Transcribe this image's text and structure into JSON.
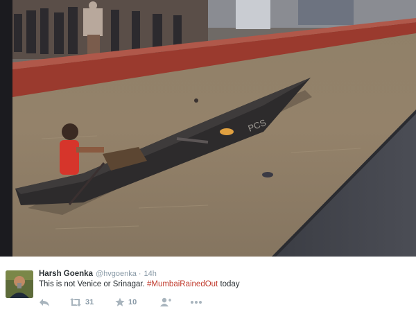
{
  "photo": {
    "description_icon": "flooded-railway-platform-photo",
    "boat_label": "PCS"
  },
  "tweet": {
    "author_name": "Harsh Goenka",
    "handle": "@hvgoenka",
    "separator": "·",
    "time": "14h",
    "text_before": "This is not Venice or Srinagar. ",
    "hashtag": "#MumbaiRainedOut",
    "text_after": " today",
    "hashtag_color": "#c0392b",
    "actions": {
      "reply_icon": "reply-icon",
      "retweet_icon": "retweet-icon",
      "retweet_count": "31",
      "favorite_icon": "star-icon",
      "favorite_count": "10",
      "follow_icon": "add-user-icon",
      "more_icon": "more-icon"
    }
  }
}
